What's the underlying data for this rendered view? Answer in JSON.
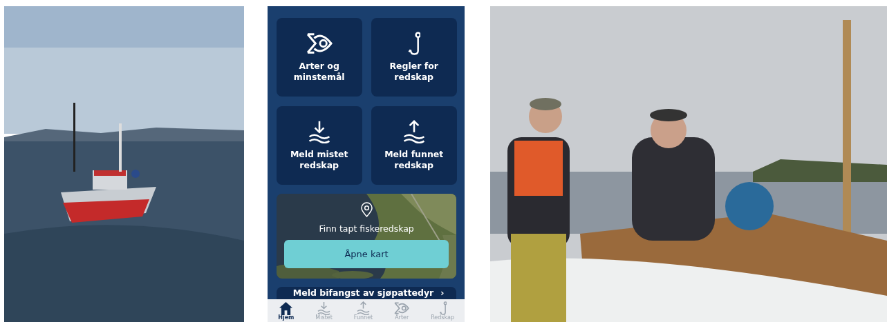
{
  "app": {
    "tiles": [
      {
        "kind": "fish",
        "label": "Arter og minstemål"
      },
      {
        "kind": "hook",
        "label": "Regler for redskap"
      },
      {
        "kind": "down",
        "label": "Meld mistet redskap"
      },
      {
        "kind": "up",
        "label": "Meld funnet redskap"
      }
    ],
    "map_card": {
      "title": "Finn tapt fiskeredskap",
      "button": "Åpne kart"
    },
    "report_row": {
      "label": "Meld bifangst av sjøpattedyr",
      "arrow": "›"
    },
    "tab_bar": [
      {
        "kind": "home",
        "label": "Hjem",
        "selected": true
      },
      {
        "kind": "down",
        "label": "Mistet",
        "selected": false
      },
      {
        "kind": "up",
        "label": "Funnet",
        "selected": false
      },
      {
        "kind": "fish",
        "label": "Arter",
        "selected": false
      },
      {
        "kind": "hook",
        "label": "Redskap",
        "selected": false
      }
    ]
  }
}
